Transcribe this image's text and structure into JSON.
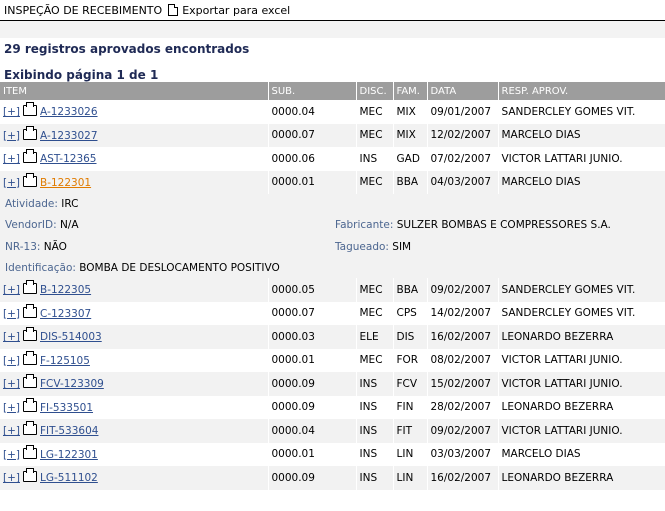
{
  "header": {
    "title": "INSPEÇÃO DE RECEBIMENTO",
    "export_label": "Exportar para excel"
  },
  "summary": {
    "found": "29 registros aprovados encontrados",
    "page": "Exibindo página 1 de 1"
  },
  "columns": {
    "item": "ITEM",
    "sub": "SUB.",
    "disc": "DISC.",
    "fam": "FAM.",
    "data": "DATA",
    "resp": "RESP. APROV."
  },
  "expand_label": "[+]",
  "rows": [
    {
      "item": "A-1233026",
      "sub": "0000.04",
      "disc": "MEC",
      "fam": "MIX",
      "data": "09/01/2007",
      "resp": "SANDERCLEY GOMES VIT."
    },
    {
      "item": "A-1233027",
      "sub": "0000.07",
      "disc": "MEC",
      "fam": "MIX",
      "data": "12/02/2007",
      "resp": "MARCELO DIAS"
    },
    {
      "item": "AST-12365",
      "sub": "0000.06",
      "disc": "INS",
      "fam": "GAD",
      "data": "07/02/2007",
      "resp": "VICTOR LATTARI JUNIO."
    },
    {
      "item": "B-122301",
      "sub": "0000.01",
      "disc": "MEC",
      "fam": "BBA",
      "data": "04/03/2007",
      "resp": "MARCELO DIAS"
    },
    {
      "item": "B-122305",
      "sub": "0000.05",
      "disc": "MEC",
      "fam": "BBA",
      "data": "09/02/2007",
      "resp": "SANDERCLEY GOMES VIT."
    },
    {
      "item": "C-123307",
      "sub": "0000.07",
      "disc": "MEC",
      "fam": "CPS",
      "data": "14/02/2007",
      "resp": "SANDERCLEY GOMES VIT."
    },
    {
      "item": "DIS-514003",
      "sub": "0000.03",
      "disc": "ELE",
      "fam": "DIS",
      "data": "16/02/2007",
      "resp": "LEONARDO BEZERRA"
    },
    {
      "item": "F-125105",
      "sub": "0000.01",
      "disc": "MEC",
      "fam": "FOR",
      "data": "08/02/2007",
      "resp": "VICTOR LATTARI JUNIO."
    },
    {
      "item": "FCV-123309",
      "sub": "0000.09",
      "disc": "INS",
      "fam": "FCV",
      "data": "15/02/2007",
      "resp": "VICTOR LATTARI JUNIO."
    },
    {
      "item": "FI-533501",
      "sub": "0000.09",
      "disc": "INS",
      "fam": "FIN",
      "data": "28/02/2007",
      "resp": "LEONARDO BEZERRA"
    },
    {
      "item": "FIT-533604",
      "sub": "0000.04",
      "disc": "INS",
      "fam": "FIT",
      "data": "09/02/2007",
      "resp": "VICTOR LATTARI JUNIO."
    },
    {
      "item": "LG-122301",
      "sub": "0000.01",
      "disc": "INS",
      "fam": "LIN",
      "data": "03/03/2007",
      "resp": "MARCELO DIAS"
    },
    {
      "item": "LG-511102",
      "sub": "0000.09",
      "disc": "INS",
      "fam": "LIN",
      "data": "16/02/2007",
      "resp": "LEONARDO BEZERRA"
    }
  ],
  "detail": {
    "atividade_label": "Atividade:",
    "atividade": "IRC",
    "vendor_label": "VendorID:",
    "vendor": "N/A",
    "fabricante_label": "Fabricante:",
    "fabricante": "SULZER BOMBAS E COMPRESSORES S.A.",
    "nr13_label": "NR-13:",
    "nr13": "NÃO",
    "tagueado_label": "Tagueado:",
    "tagueado": "SIM",
    "ident_label": "Identificação:",
    "ident": "BOMBA DE DESLOCAMENTO POSITIVO"
  }
}
